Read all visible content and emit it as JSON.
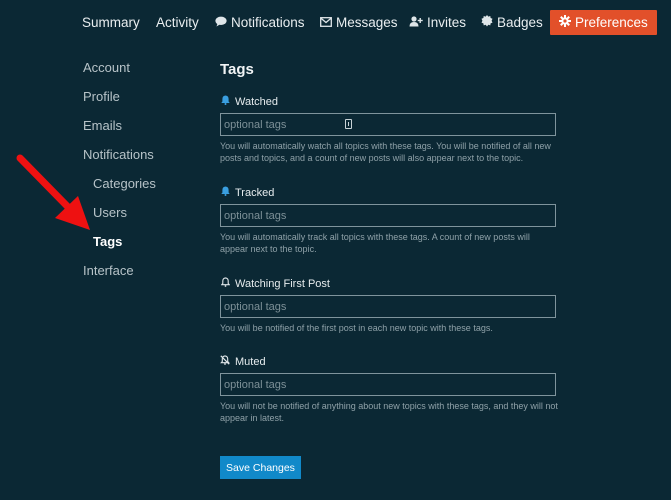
{
  "topnav": {
    "items": [
      {
        "label": "Summary"
      },
      {
        "label": "Activity"
      },
      {
        "label": "Notifications",
        "icon": "speech-bubble-icon"
      },
      {
        "label": "Messages",
        "icon": "envelope-icon"
      },
      {
        "label": "Invites",
        "icon": "user-plus-icon"
      },
      {
        "label": "Badges",
        "icon": "badge-certificate-icon"
      },
      {
        "label": "Preferences",
        "icon": "gear-icon",
        "active": true
      }
    ]
  },
  "sidebar": {
    "items": [
      {
        "label": "Account"
      },
      {
        "label": "Profile"
      },
      {
        "label": "Emails"
      },
      {
        "label": "Notifications"
      },
      {
        "label": "Categories"
      },
      {
        "label": "Users"
      },
      {
        "label": "Tags",
        "current": true
      },
      {
        "label": "Interface"
      }
    ]
  },
  "main": {
    "title": "Tags",
    "sections": [
      {
        "label": "Watched",
        "icon": "bell-filled-icon",
        "placeholder": "optional tags",
        "help": "You will automatically watch all topics with these tags. You will be notified of all new posts and topics, and a count of new posts will also appear next to the topic."
      },
      {
        "label": "Tracked",
        "icon": "bell-filled-icon",
        "placeholder": "optional tags",
        "help": "You will automatically track all topics with these tags. A count of new posts will appear next to the topic."
      },
      {
        "label": "Watching First Post",
        "icon": "bell-outline-icon",
        "placeholder": "optional tags",
        "help": "You will be notified of the first post in each new topic with these tags."
      },
      {
        "label": "Muted",
        "icon": "bell-slash-icon",
        "placeholder": "optional tags",
        "help": "You will not be notified of anything about new topics with these tags, and they will not appear in latest."
      }
    ],
    "save_label": "Save Changes"
  },
  "colors": {
    "background": "#0b2834",
    "active_tab": "#e2502a",
    "primary_button": "#1189c9",
    "annotation_arrow": "#ee1111"
  }
}
